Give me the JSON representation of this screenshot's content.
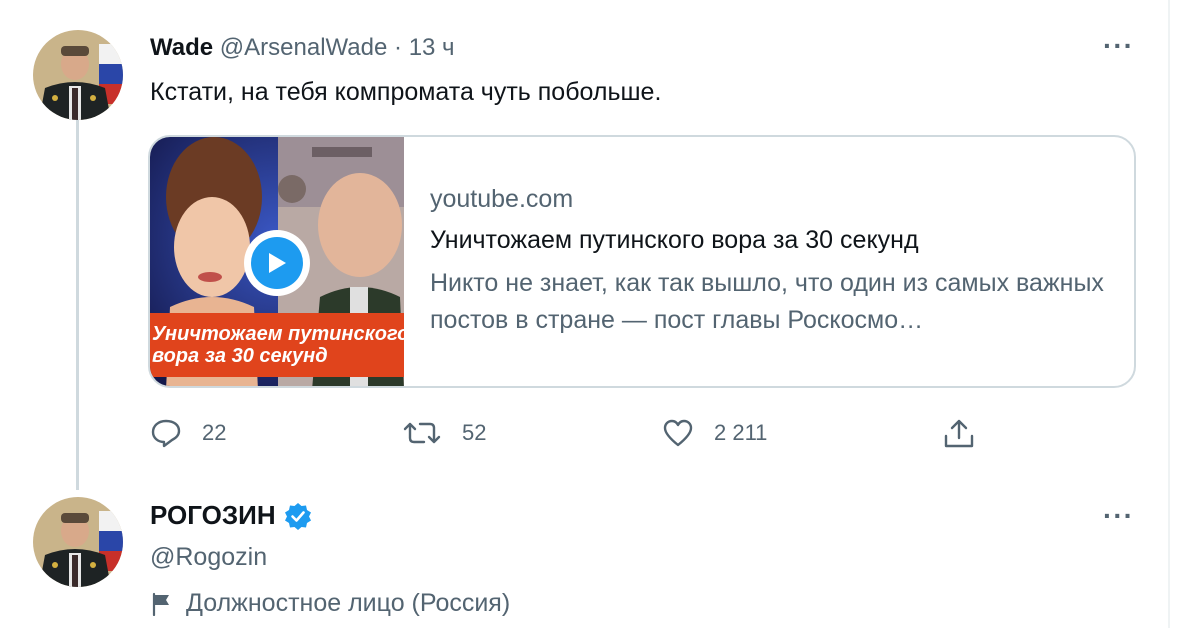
{
  "tweet": {
    "author_name": "Wade",
    "author_handle": "@ArsenalWade",
    "separator": "·",
    "time": "13 ч",
    "text": "Кстати, на тебя компромата чуть побольше.",
    "more_label": "···",
    "card": {
      "domain": "youtube.com",
      "title": "Уничтожаем путинского вора за 30 секунд",
      "description": "Никто не знает, как так вышло, что один из самых важных постов в стране — пост главы Роскосмо…",
      "thumbnail_caption_line1": "Уничтожаем путинского",
      "thumbnail_caption_line2": "вора за 30 секунд"
    },
    "actions": {
      "reply_count": "22",
      "retweet_count": "52",
      "like_count": "2 211"
    }
  },
  "profile": {
    "name": "РОГОЗИН",
    "handle": "@Rogozin",
    "affiliation": "Должностное лицо (Россия)",
    "more_label": "···"
  },
  "icons": {
    "reply": "reply-icon",
    "retweet": "retweet-icon",
    "like": "like-icon",
    "share": "share-icon",
    "verified": "verified-badge-icon",
    "flag": "flag-icon",
    "play": "play-icon"
  },
  "colors": {
    "accent": "#1d9bf0",
    "muted_text": "#536471",
    "primary_text": "#0f1419",
    "border": "#cfd9de",
    "thumbnail_banner": "#e0441c"
  }
}
